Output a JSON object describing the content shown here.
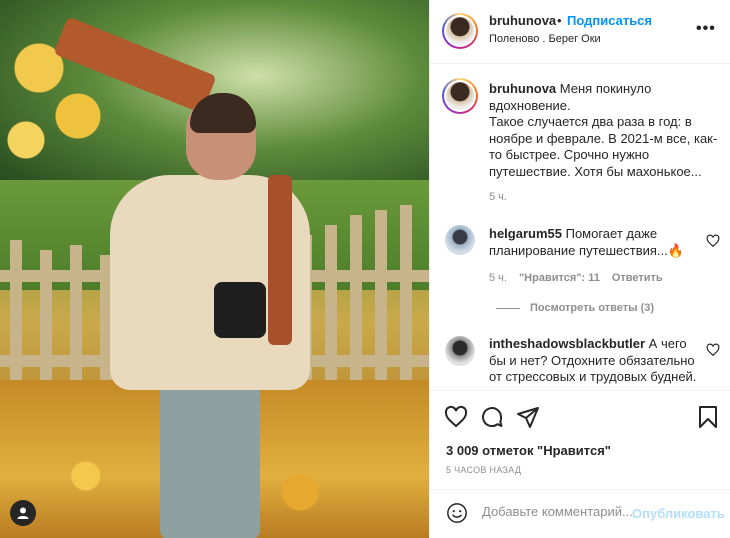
{
  "post": {
    "username": "bruhunova",
    "dot": "•",
    "follow_label": "Подписаться",
    "location": "Поленово . Берег Оки",
    "more_label": "•••"
  },
  "caption": {
    "username": "bruhunova",
    "line1": " Меня покинуло вдохновение.",
    "line2": "Такое случается два раза в год: в ноябре и феврале. В 2021-м все, как-то быстрее. Срочно нужно путешествие. Хотя бы махонькое...",
    "time": "5 ч."
  },
  "comments": [
    {
      "username": "helgarum55",
      "text": " Помогает даже планирование путешествия...",
      "emoji": "🔥",
      "time": "5 ч.",
      "likes": "\"Нравится\": 11",
      "reply": "Ответить"
    },
    {
      "username": "intheshadowsblackbutler",
      "text": " А чего бы и нет? Отдохните обязательно от стрессовых и трудовых будней."
    }
  ],
  "replies_label": "Посмотреть ответы (3)",
  "likes_text": "3 009 отметок \"Нравится\"",
  "posted_ago": "5 ЧАСОВ НАЗАД",
  "comment_box": {
    "placeholder": "Добавьте комментарий...",
    "publish_label": "Опубликовать"
  },
  "colors": {
    "link": "#0095f6",
    "publish_disabled": "#b2dffc",
    "muted": "#8e8e8e"
  }
}
